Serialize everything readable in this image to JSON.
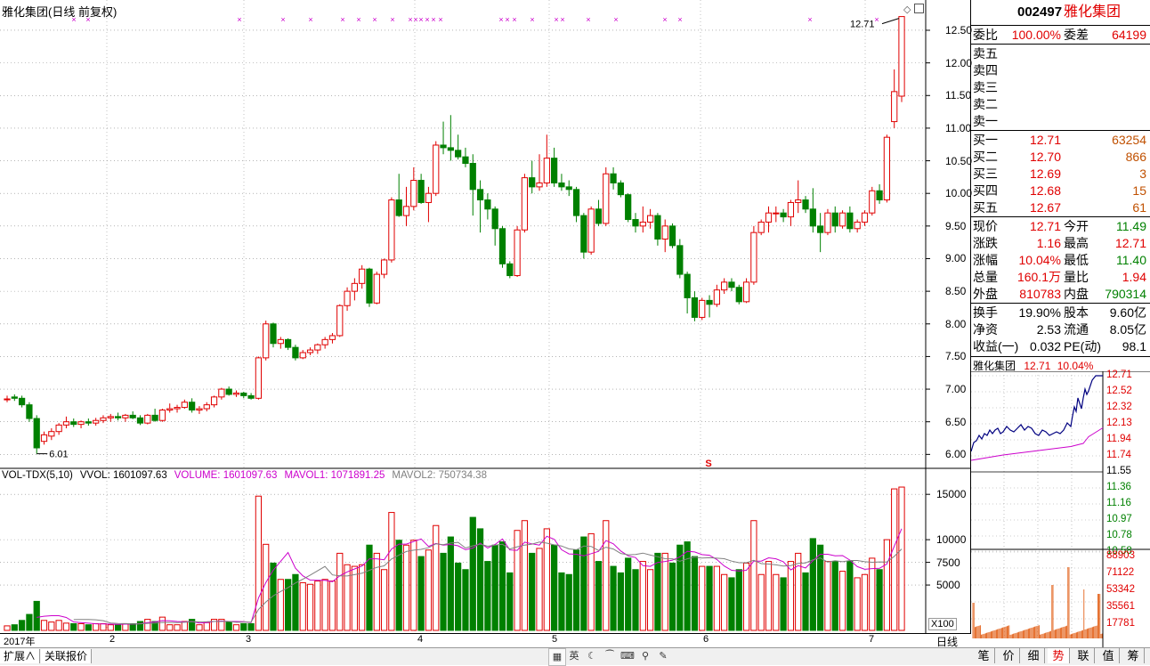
{
  "chart_title": "雅化集团(日线 前复权)",
  "markers": {
    "high_label": "12.71",
    "low_label": "6.01",
    "s_marker": "S"
  },
  "price_axis": [
    "12.50",
    "12.00",
    "11.50",
    "11.00",
    "10.50",
    "10.00",
    "9.50",
    "9.00",
    "8.50",
    "8.00",
    "7.50",
    "7.00",
    "6.50",
    "6.00"
  ],
  "volume_header": {
    "indicator": "VOL-TDX(5,10)",
    "vvol": "VVOL: 1601097.63",
    "volume": "VOLUME: 1601097.63",
    "mavol1": "MAVOL1: 1071891.25",
    "mavol2": "MAVOL2: 750734.38"
  },
  "volume_axis": [
    "15000",
    "10000",
    "7500",
    "5000"
  ],
  "volume_unit": "X100",
  "x_axis": [
    "2017年",
    "2",
    "3",
    "4",
    "5",
    "6",
    "7"
  ],
  "period_label": "日线",
  "bottom_tabs": [
    "扩展∧",
    "关联报价"
  ],
  "toolbar_icons": [
    "grid-icon",
    "english-icon",
    "moon-icon",
    "tail-icon",
    "keyboard-icon",
    "link-icon",
    "wrench-icon"
  ],
  "toolbar_text": {
    "en": "英"
  },
  "quote": {
    "code": "002497",
    "name": "雅化集团",
    "weibi_label": "委比",
    "weibi": "100.00%",
    "weicha_label": "委差",
    "weicha": "64199",
    "sell": [
      {
        "label": "卖五"
      },
      {
        "label": "卖四"
      },
      {
        "label": "卖三"
      },
      {
        "label": "卖二"
      },
      {
        "label": "卖一"
      }
    ],
    "buy": [
      {
        "label": "买一",
        "price": "12.71",
        "vol": "63254"
      },
      {
        "label": "买二",
        "price": "12.70",
        "vol": "866"
      },
      {
        "label": "买三",
        "price": "12.69",
        "vol": "3"
      },
      {
        "label": "买四",
        "price": "12.68",
        "vol": "15"
      },
      {
        "label": "买五",
        "price": "12.67",
        "vol": "61"
      }
    ],
    "stats": [
      {
        "l1": "现价",
        "v1": "12.71",
        "c1": "red",
        "l2": "今开",
        "v2": "11.49",
        "c2": "green"
      },
      {
        "l1": "涨跌",
        "v1": "1.16",
        "c1": "red",
        "l2": "最高",
        "v2": "12.71",
        "c2": "red"
      },
      {
        "l1": "涨幅",
        "v1": "10.04%",
        "c1": "red",
        "l2": "最低",
        "v2": "11.40",
        "c2": "green"
      },
      {
        "l1": "总量",
        "v1": "160.1万",
        "c1": "red",
        "l2": "量比",
        "v2": "1.94",
        "c2": "red"
      },
      {
        "l1": "外盘",
        "v1": "810783",
        "c1": "red",
        "l2": "内盘",
        "v2": "790314",
        "c2": "green"
      }
    ],
    "fundamentals": [
      {
        "l1": "换手",
        "v1": "19.90%",
        "l2": "股本",
        "v2": "9.60亿"
      },
      {
        "l1": "净资",
        "v1": "2.53",
        "l2": "流通",
        "v2": "8.05亿"
      },
      {
        "l1": "收益(一)",
        "v1": "0.032",
        "l2": "PE(动)",
        "v2": "98.1"
      }
    ]
  },
  "mini": {
    "name": "雅化集团",
    "price": "12.71",
    "pct": "10.04%",
    "price_axis": [
      "12.71",
      "12.52",
      "12.32",
      "12.13",
      "11.94",
      "11.74",
      "11.55",
      "11.36",
      "11.16",
      "10.97",
      "10.78",
      "10.58"
    ],
    "vol_axis": [
      "88903",
      "71122",
      "53342",
      "35561",
      "17781"
    ]
  },
  "right_tabs": [
    "笔",
    "价",
    "细",
    "势",
    "联",
    "值",
    "筹"
  ],
  "colors": {
    "up": "#e00000",
    "down": "#008000",
    "ma1": "#cc00cc",
    "ma2": "#808080",
    "navy": "#000080"
  },
  "chart_data": {
    "type": "candlestick",
    "x_months": [
      "2017年",
      "2",
      "3",
      "4",
      "5",
      "6",
      "7"
    ],
    "ohlc_approx": [
      [
        6.85,
        6.9,
        6.8,
        6.85
      ],
      [
        6.88,
        6.92,
        6.82,
        6.86
      ],
      [
        6.86,
        6.9,
        6.72,
        6.76
      ],
      [
        6.76,
        6.8,
        6.5,
        6.55
      ],
      [
        6.55,
        6.6,
        6.01,
        6.1
      ],
      [
        6.2,
        6.35,
        6.15,
        6.3
      ],
      [
        6.28,
        6.4,
        6.22,
        6.35
      ],
      [
        6.35,
        6.48,
        6.3,
        6.45
      ],
      [
        6.45,
        6.58,
        6.4,
        6.5
      ],
      [
        6.5,
        6.55,
        6.42,
        6.46
      ],
      [
        6.46,
        6.52,
        6.4,
        6.5
      ],
      [
        6.5,
        6.55,
        6.44,
        6.48
      ],
      [
        6.48,
        6.56,
        6.44,
        6.52
      ],
      [
        6.52,
        6.6,
        6.48,
        6.56
      ],
      [
        6.56,
        6.62,
        6.5,
        6.58
      ],
      [
        6.58,
        6.64,
        6.52,
        6.56
      ],
      [
        6.56,
        6.62,
        6.5,
        6.6
      ],
      [
        6.6,
        6.66,
        6.54,
        6.56
      ],
      [
        6.56,
        6.6,
        6.45,
        6.48
      ],
      [
        6.48,
        6.62,
        6.46,
        6.6
      ],
      [
        6.6,
        6.7,
        6.5,
        6.52
      ],
      [
        6.52,
        6.7,
        6.5,
        6.68
      ],
      [
        6.68,
        6.78,
        6.64,
        6.7
      ],
      [
        6.7,
        6.76,
        6.64,
        6.72
      ],
      [
        6.72,
        6.84,
        6.7,
        6.8
      ],
      [
        6.8,
        6.86,
        6.64,
        6.68
      ],
      [
        6.68,
        6.74,
        6.62,
        6.7
      ],
      [
        6.7,
        6.8,
        6.66,
        6.76
      ],
      [
        6.76,
        6.9,
        6.72,
        6.88
      ],
      [
        6.88,
        7.02,
        6.84,
        7.0
      ],
      [
        7.0,
        7.04,
        6.9,
        6.92
      ],
      [
        6.92,
        6.98,
        6.88,
        6.94
      ],
      [
        6.94,
        6.96,
        6.86,
        6.9
      ],
      [
        6.9,
        6.94,
        6.84,
        6.86
      ],
      [
        6.86,
        7.5,
        6.84,
        7.48
      ],
      [
        7.48,
        8.05,
        7.44,
        8.0
      ],
      [
        8.0,
        8.02,
        7.64,
        7.7
      ],
      [
        7.7,
        7.8,
        7.62,
        7.76
      ],
      [
        7.76,
        7.78,
        7.6,
        7.64
      ],
      [
        7.64,
        7.68,
        7.44,
        7.48
      ],
      [
        7.48,
        7.6,
        7.46,
        7.56
      ],
      [
        7.56,
        7.64,
        7.52,
        7.6
      ],
      [
        7.6,
        7.7,
        7.54,
        7.68
      ],
      [
        7.68,
        7.8,
        7.62,
        7.76
      ],
      [
        7.76,
        7.86,
        7.7,
        7.82
      ],
      [
        7.82,
        8.3,
        7.8,
        8.28
      ],
      [
        8.28,
        8.56,
        8.2,
        8.5
      ],
      [
        8.5,
        8.7,
        8.36,
        8.62
      ],
      [
        8.62,
        8.9,
        8.54,
        8.84
      ],
      [
        8.84,
        8.86,
        8.26,
        8.32
      ],
      [
        8.32,
        8.8,
        8.3,
        8.76
      ],
      [
        8.76,
        9.0,
        8.7,
        8.98
      ],
      [
        8.98,
        9.94,
        8.94,
        9.9
      ],
      [
        9.9,
        10.3,
        9.64,
        9.66
      ],
      [
        9.66,
        10.1,
        9.5,
        9.8
      ],
      [
        9.8,
        10.4,
        9.74,
        10.2
      ],
      [
        10.2,
        10.3,
        9.84,
        9.86
      ],
      [
        9.86,
        10.1,
        9.56,
        10.0
      ],
      [
        10.0,
        10.8,
        9.96,
        10.74
      ],
      [
        10.74,
        11.1,
        10.6,
        10.7
      ],
      [
        10.7,
        11.2,
        10.5,
        10.66
      ],
      [
        10.66,
        10.9,
        10.52,
        10.56
      ],
      [
        10.56,
        10.7,
        10.4,
        10.46
      ],
      [
        10.46,
        10.6,
        9.66,
        10.06
      ],
      [
        10.06,
        10.2,
        9.4,
        9.9
      ],
      [
        9.9,
        10.0,
        9.6,
        9.76
      ],
      [
        9.76,
        9.8,
        9.2,
        9.46
      ],
      [
        9.46,
        9.5,
        8.86,
        8.92
      ],
      [
        8.92,
        8.96,
        8.7,
        8.74
      ],
      [
        8.74,
        9.5,
        8.72,
        9.44
      ],
      [
        9.44,
        10.3,
        9.4,
        10.24
      ],
      [
        10.24,
        10.5,
        10.0,
        10.1
      ],
      [
        10.1,
        10.6,
        10.04,
        10.16
      ],
      [
        10.16,
        10.9,
        10.1,
        10.54
      ],
      [
        10.54,
        10.7,
        10.1,
        10.16
      ],
      [
        10.16,
        10.3,
        10.04,
        10.1
      ],
      [
        10.1,
        10.2,
        9.96,
        10.06
      ],
      [
        10.06,
        10.1,
        9.56,
        9.66
      ],
      [
        9.66,
        9.7,
        9.0,
        9.1
      ],
      [
        9.1,
        9.8,
        9.06,
        9.76
      ],
      [
        9.76,
        9.9,
        9.5,
        9.54
      ],
      [
        9.54,
        10.4,
        9.5,
        10.3
      ],
      [
        10.3,
        10.4,
        10.06,
        10.16
      ],
      [
        10.16,
        10.2,
        9.94,
        9.98
      ],
      [
        9.98,
        10.0,
        9.56,
        9.6
      ],
      [
        9.6,
        9.7,
        9.4,
        9.5
      ],
      [
        9.5,
        9.8,
        9.4,
        9.56
      ],
      [
        9.56,
        9.76,
        9.46,
        9.66
      ],
      [
        9.66,
        9.7,
        9.2,
        9.3
      ],
      [
        9.3,
        9.6,
        9.1,
        9.5
      ],
      [
        9.5,
        9.54,
        9.16,
        9.2
      ],
      [
        9.2,
        9.3,
        8.7,
        8.76
      ],
      [
        8.76,
        8.8,
        8.16,
        8.4
      ],
      [
        8.4,
        8.5,
        8.04,
        8.1
      ],
      [
        8.1,
        8.4,
        8.06,
        8.36
      ],
      [
        8.36,
        8.44,
        8.1,
        8.3
      ],
      [
        8.3,
        8.6,
        8.26,
        8.52
      ],
      [
        8.52,
        8.7,
        8.46,
        8.64
      ],
      [
        8.64,
        8.7,
        8.5,
        8.56
      ],
      [
        8.56,
        8.6,
        8.3,
        8.34
      ],
      [
        8.34,
        8.7,
        8.32,
        8.64
      ],
      [
        8.64,
        9.5,
        8.6,
        9.4
      ],
      [
        9.4,
        9.6,
        9.36,
        9.56
      ],
      [
        9.56,
        9.8,
        9.4,
        9.7
      ],
      [
        9.7,
        9.8,
        9.56,
        9.7
      ],
      [
        9.7,
        9.76,
        9.56,
        9.64
      ],
      [
        9.64,
        9.9,
        9.5,
        9.86
      ],
      [
        9.86,
        10.2,
        9.7,
        9.9
      ],
      [
        9.9,
        9.96,
        9.7,
        9.76
      ],
      [
        9.76,
        10.08,
        9.4,
        9.5
      ],
      [
        9.5,
        9.7,
        9.1,
        9.4
      ],
      [
        9.4,
        9.76,
        9.36,
        9.7
      ],
      [
        9.7,
        9.8,
        9.4,
        9.5
      ],
      [
        9.5,
        9.74,
        9.46,
        9.7
      ],
      [
        9.7,
        9.8,
        9.4,
        9.46
      ],
      [
        9.46,
        9.6,
        9.4,
        9.56
      ],
      [
        9.56,
        9.74,
        9.5,
        9.7
      ],
      [
        9.7,
        10.1,
        9.66,
        10.04
      ],
      [
        10.04,
        10.14,
        9.84,
        9.9
      ],
      [
        9.9,
        10.9,
        9.86,
        10.86
      ],
      [
        11.1,
        11.9,
        11.0,
        11.56
      ],
      [
        11.49,
        12.71,
        11.4,
        12.71
      ]
    ],
    "ylim": [
      5.8,
      12.8
    ],
    "volume_axis_ticks": [
      "15000",
      "10000",
      "7500",
      "5000"
    ]
  }
}
